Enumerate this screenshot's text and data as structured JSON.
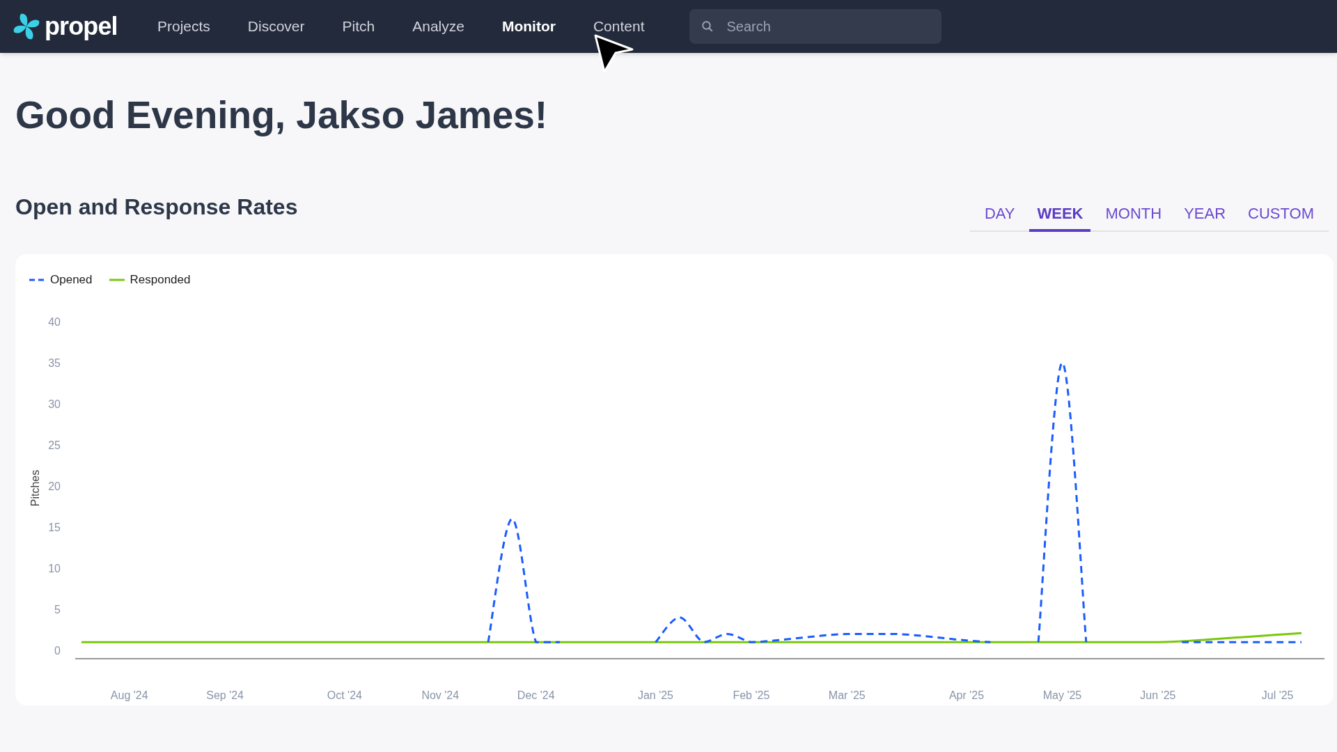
{
  "nav": {
    "logo": "propel",
    "items": [
      {
        "label": "Projects",
        "selected": false
      },
      {
        "label": "Discover",
        "selected": false
      },
      {
        "label": "Pitch",
        "selected": false
      },
      {
        "label": "Analyze",
        "selected": false
      },
      {
        "label": "Monitor",
        "selected": true
      },
      {
        "label": "Content",
        "selected": false
      }
    ],
    "search": {
      "placeholder": "Search"
    }
  },
  "greeting": "Good Evening, Jakso James!",
  "section": {
    "title": "Open and Response Rates",
    "tabs": [
      {
        "label": "DAY",
        "selected": false
      },
      {
        "label": "WEEK",
        "selected": true
      },
      {
        "label": "MONTH",
        "selected": false
      },
      {
        "label": "YEAR",
        "selected": false
      },
      {
        "label": "CUSTOM",
        "selected": false
      }
    ]
  },
  "chart_data": {
    "type": "line",
    "ylabel": "Pitches",
    "ylim": [
      0,
      40
    ],
    "yticks": [
      0,
      5,
      10,
      15,
      20,
      25,
      30,
      35,
      40
    ],
    "categories": [
      null,
      null,
      "Aug '24",
      null,
      null,
      null,
      "Sep '24",
      null,
      null,
      null,
      null,
      "Oct '24",
      null,
      null,
      null,
      "Nov '24",
      null,
      null,
      null,
      "Dec '24",
      null,
      null,
      null,
      null,
      "Jan '25",
      null,
      null,
      null,
      "Feb '25",
      null,
      null,
      null,
      "Mar '25",
      null,
      null,
      null,
      null,
      "Apr '25",
      null,
      null,
      null,
      "May '25",
      null,
      null,
      null,
      "Jun '25",
      null,
      null,
      null,
      null,
      "Jul '25",
      null
    ],
    "legend": "top-left",
    "series": [
      {
        "name": "Opened",
        "color": "#1a5cff",
        "line_style": "dashed",
        "values": [
          null,
          null,
          null,
          null,
          null,
          null,
          null,
          null,
          null,
          null,
          null,
          null,
          null,
          null,
          null,
          null,
          null,
          1,
          16,
          1,
          1,
          null,
          null,
          null,
          1,
          4,
          1,
          2,
          1,
          1.2,
          1.5,
          1.8,
          2,
          2,
          2,
          1.8,
          1.5,
          1.2,
          1,
          null,
          1,
          35,
          1,
          null,
          null,
          null,
          1,
          1,
          1,
          1,
          1,
          1
        ]
      },
      {
        "name": "Responded",
        "color": "#7ac70c",
        "line_style": "solid",
        "values": [
          1,
          1,
          1,
          1,
          1,
          1,
          1,
          1,
          1,
          1,
          1,
          1,
          1,
          1,
          1,
          1,
          1,
          1,
          1,
          1,
          1,
          1,
          1,
          1,
          1,
          1,
          1,
          1,
          1,
          1,
          1,
          1,
          1,
          1,
          1,
          1,
          1,
          1,
          1,
          1,
          1,
          1,
          1,
          1,
          1,
          1,
          1.1,
          1.3,
          1.5,
          1.7,
          1.9,
          2.1
        ]
      }
    ]
  }
}
